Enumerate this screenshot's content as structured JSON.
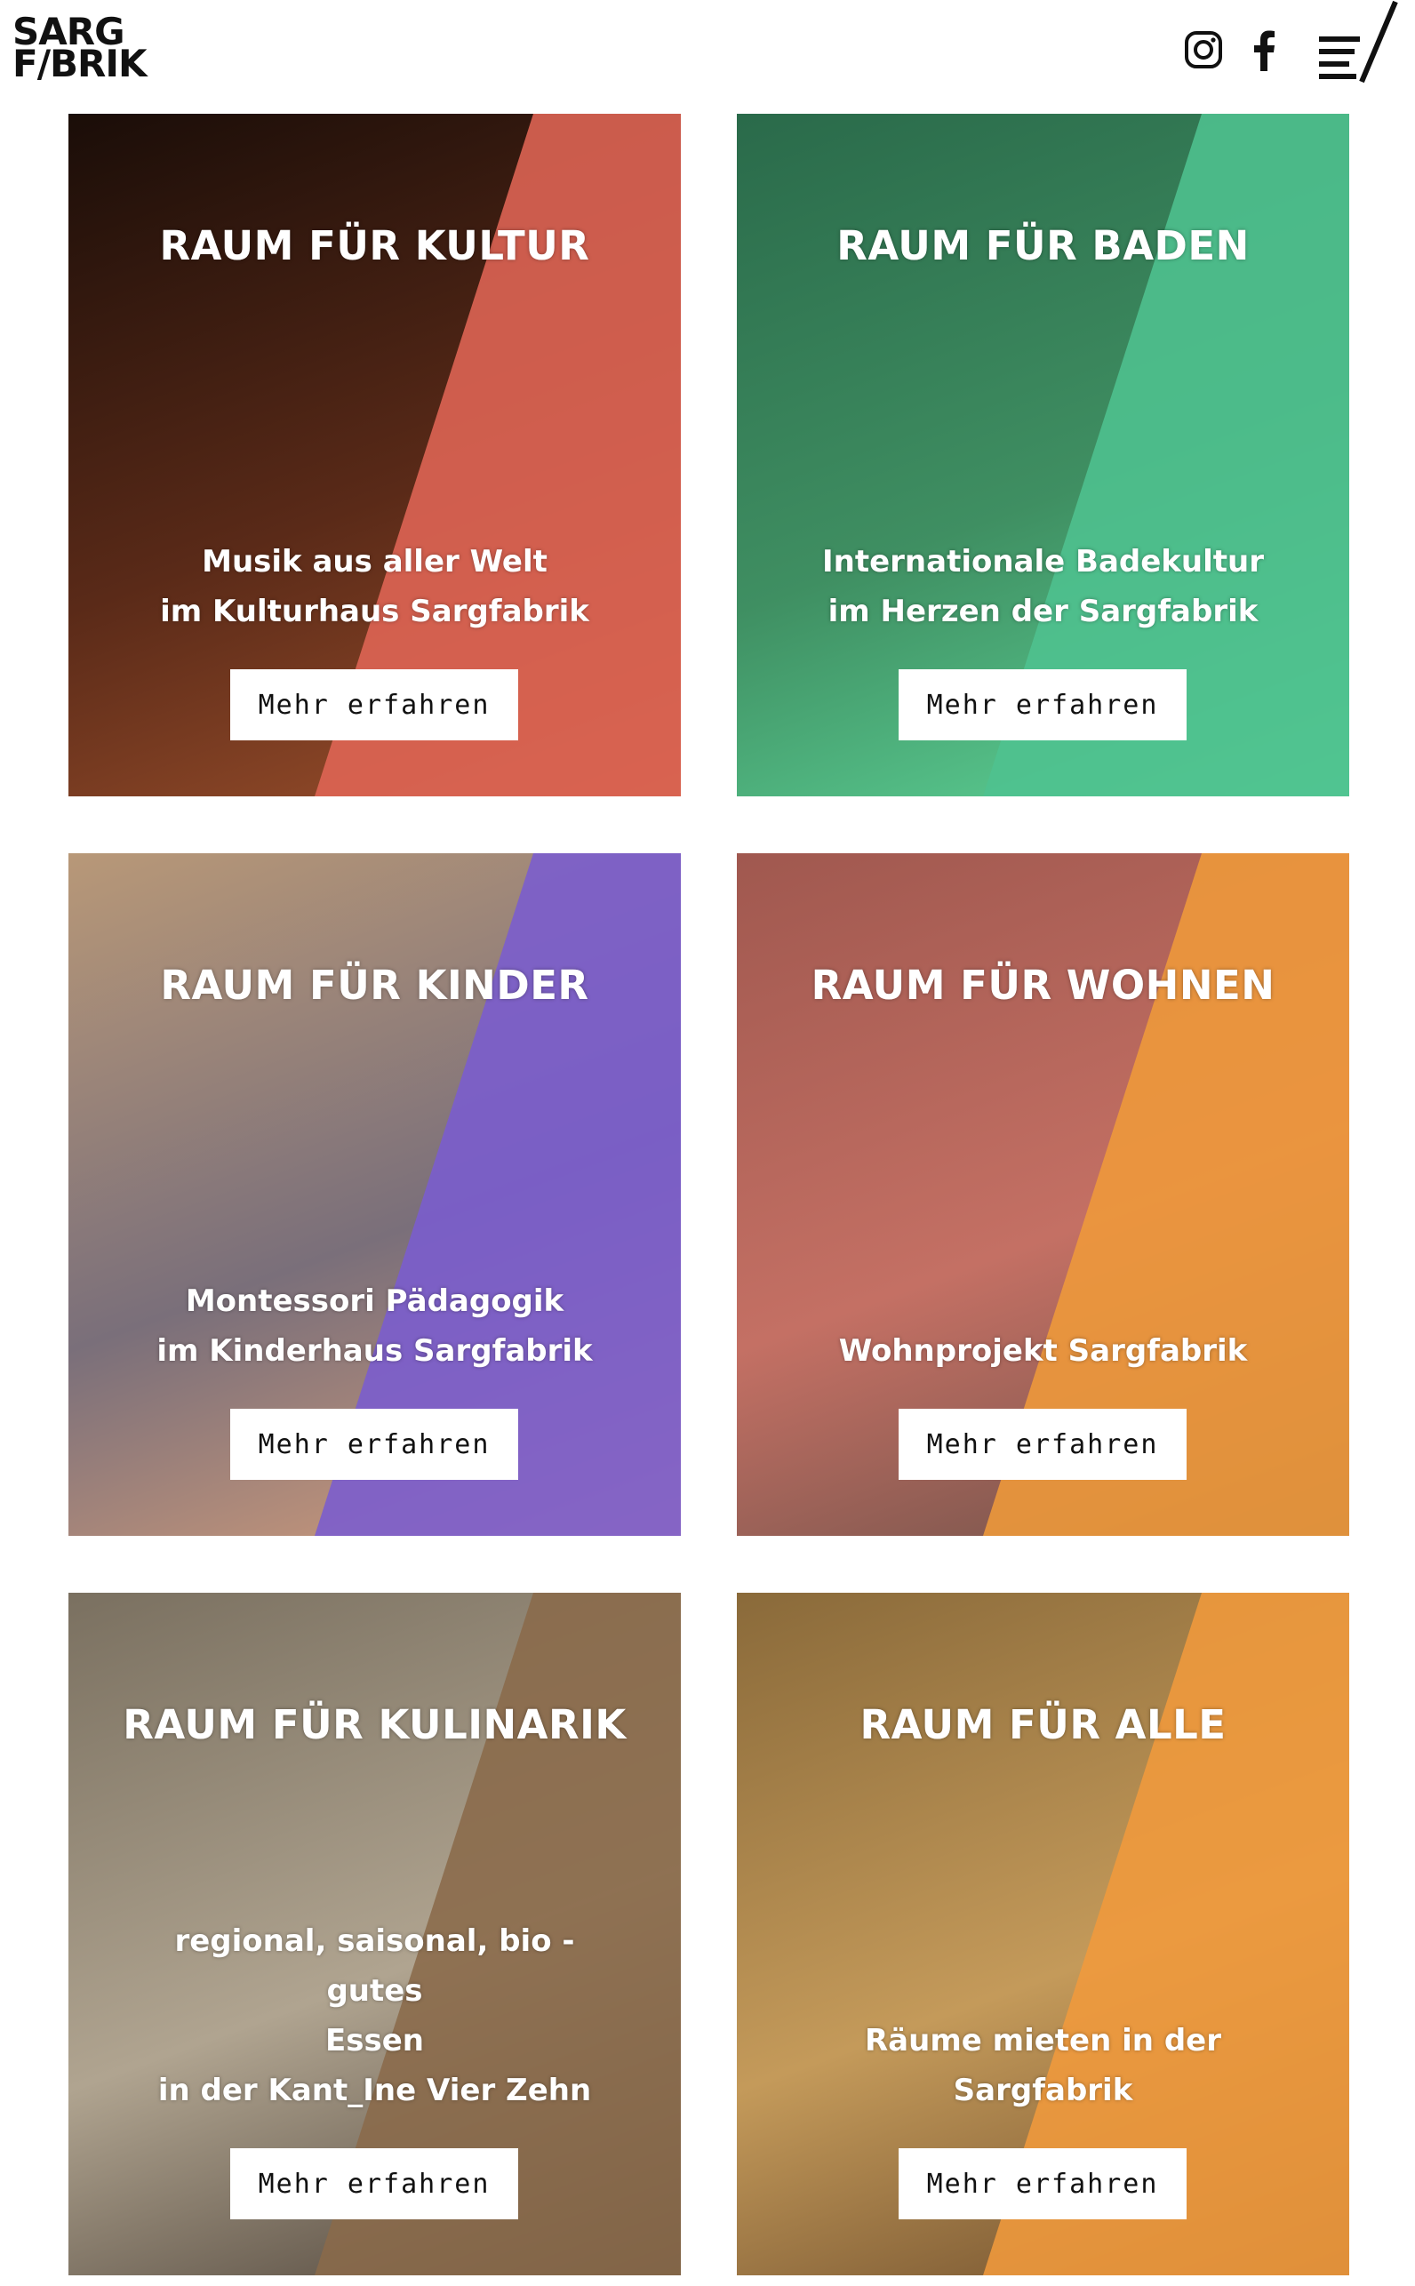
{
  "header": {
    "logo_line1": "SARG",
    "logo_line2": "F/BRIK",
    "icons": [
      "instagram-icon",
      "facebook-icon",
      "menu-icon"
    ]
  },
  "cards": [
    {
      "title": "RAUM FÜR KULTUR",
      "subtitle": [
        "Musik aus aller Welt",
        "im Kulturhaus Sargfabrik"
      ],
      "button": "Mehr erfahren",
      "accent": "#e06555",
      "photo_colors": [
        "#1a0d08",
        "#5a2a18",
        "#a0522d"
      ]
    },
    {
      "title": "RAUM FÜR BADEN",
      "subtitle": [
        "Internationale Badekultur",
        "im Herzen der Sargfabrik"
      ],
      "button": "Mehr erfahren",
      "accent": "#4fc28f",
      "photo_colors": [
        "#2a6a4a",
        "#3f8f62",
        "#5fd89b"
      ]
    },
    {
      "title": "RAUM FÜR KINDER",
      "subtitle": [
        "Montessori Pädagogik",
        "im Kinderhaus Sargfabrik"
      ],
      "button": "Mehr erfahren",
      "accent": "#7a5ccf",
      "photo_colors": [
        "#b89878",
        "#7a6f7a",
        "#d9a07a"
      ]
    },
    {
      "title": "RAUM FÜR WOHNEN",
      "subtitle": [
        "Wohnprojekt Sargfabrik"
      ],
      "button": "Mehr erfahren",
      "accent": "#ef9a3a",
      "photo_colors": [
        "#a0584f",
        "#c47064",
        "#6a5048"
      ]
    },
    {
      "title": "RAUM FÜR KULINARIK",
      "subtitle": [
        "regional, saisonal, bio - gutes",
        "Essen",
        "in der Kant_Ine Vier Zehn"
      ],
      "button": "Mehr erfahren",
      "accent": "#8a6a4a",
      "photo_colors": [
        "#7a7060",
        "#b0a490",
        "#4a3f35"
      ]
    },
    {
      "title": "RAUM FÜR ALLE",
      "subtitle": [
        "Räume mieten in der Sargfabrik"
      ],
      "button": "Mehr erfahren",
      "accent": "#f09a3c",
      "photo_colors": [
        "#8a6a3a",
        "#c49a5a",
        "#6a4a2a"
      ]
    }
  ]
}
